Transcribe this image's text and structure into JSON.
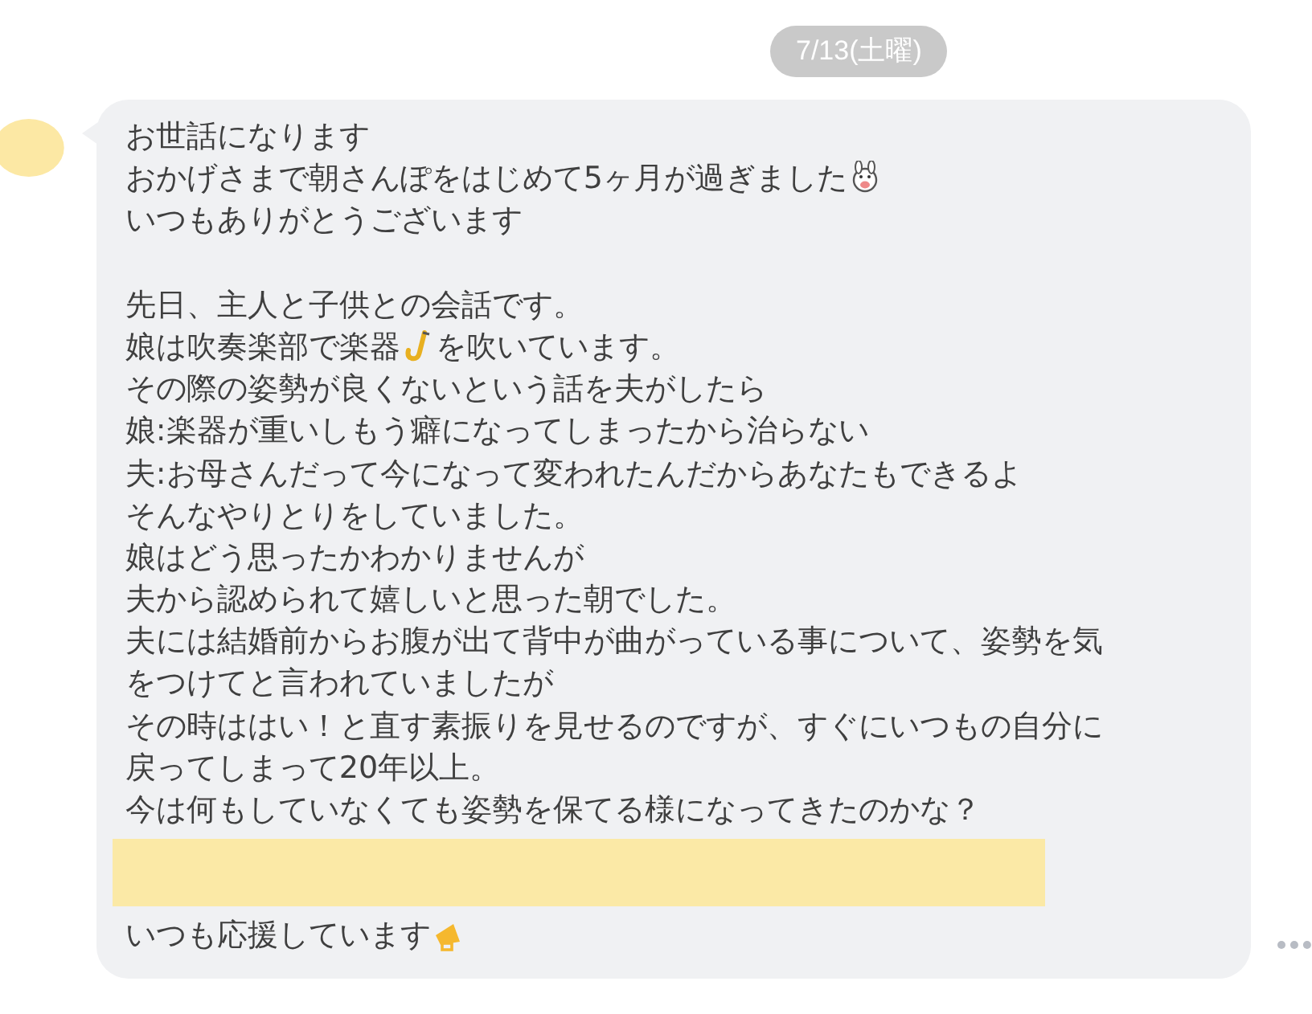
{
  "date_label": "7/13(土曜)",
  "message": {
    "lines": [
      {
        "kind": "text",
        "segments": [
          {
            "kind": "text",
            "text": "お世話になります"
          }
        ]
      },
      {
        "kind": "text",
        "segments": [
          {
            "kind": "text",
            "text": "おかげさまで朝さんぽをはじめて5ヶ月が過ぎました"
          },
          {
            "kind": "emoji"
          }
        ]
      },
      {
        "kind": "text",
        "segments": [
          {
            "kind": "text",
            "text": "いつもありがとうございます"
          }
        ]
      },
      {
        "kind": "blank"
      },
      {
        "kind": "text",
        "segments": [
          {
            "kind": "text",
            "text": "先日、主人と子供との会話です。"
          }
        ]
      },
      {
        "kind": "text",
        "segments": [
          {
            "kind": "text",
            "text": "娘は吹奏楽部で楽器"
          },
          {
            "kind": "emoji"
          },
          {
            "kind": "text",
            "text": "を吹いています。"
          }
        ]
      },
      {
        "kind": "text",
        "segments": [
          {
            "kind": "text",
            "text": "その際の姿勢が良くないという話を夫がしたら"
          }
        ]
      },
      {
        "kind": "text",
        "segments": [
          {
            "kind": "text",
            "text": "娘:楽器が重いしもう癖になってしまったから治らない"
          }
        ]
      },
      {
        "kind": "text",
        "segments": [
          {
            "kind": "text",
            "text": "夫:お母さんだって今になって変われたんだからあなたもできるよ"
          }
        ]
      },
      {
        "kind": "text",
        "segments": [
          {
            "kind": "text",
            "text": "そんなやりとりをしていました。"
          }
        ]
      },
      {
        "kind": "text",
        "segments": [
          {
            "kind": "text",
            "text": "娘はどう思ったかわかりませんが"
          }
        ]
      },
      {
        "kind": "text",
        "segments": [
          {
            "kind": "text",
            "text": "夫から認められて嬉しいと思った朝でした。"
          }
        ]
      },
      {
        "kind": "text",
        "segments": [
          {
            "kind": "text",
            "text": "夫には結婚前からお腹が出て背中が曲がっている事について、姿勢を気"
          }
        ]
      },
      {
        "kind": "text",
        "segments": [
          {
            "kind": "text",
            "text": "をつけてと言われていましたが"
          }
        ]
      },
      {
        "kind": "text",
        "segments": [
          {
            "kind": "text",
            "text": "その時ははい！と直す素振りを見せるのですが、すぐにいつもの自分に"
          }
        ]
      },
      {
        "kind": "text",
        "segments": [
          {
            "kind": "text",
            "text": "戻ってしまって20年以上。"
          }
        ]
      },
      {
        "kind": "text",
        "segments": [
          {
            "kind": "text",
            "text": "今は何もしていなくても姿勢を保てる様になってきたのかな？"
          }
        ]
      },
      {
        "kind": "redacted"
      },
      {
        "kind": "text",
        "segments": [
          {
            "kind": "text",
            "text": "いつも応援しています"
          },
          {
            "kind": "emoji"
          }
        ]
      }
    ]
  }
}
